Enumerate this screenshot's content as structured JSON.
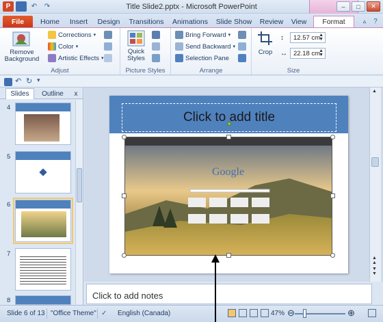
{
  "window": {
    "title": "Title Slide2.pptx - Microsoft PowerPoint",
    "controls": [
      "–",
      "□",
      "✕"
    ]
  },
  "tabs": [
    {
      "label": "File"
    },
    {
      "label": "Home"
    },
    {
      "label": "Insert"
    },
    {
      "label": "Design"
    },
    {
      "label": "Transitions"
    },
    {
      "label": "Animations"
    },
    {
      "label": "Slide Show"
    },
    {
      "label": "Review"
    },
    {
      "label": "View"
    },
    {
      "label": "Format"
    }
  ],
  "ribbon": {
    "adjust": {
      "remove_background": "Remove Background",
      "corrections": "Corrections",
      "color": "Color",
      "artistic_effects": "Artistic Effects",
      "group_label": "Adjust"
    },
    "picture_styles": {
      "quick_styles": "Quick Styles",
      "group_label": "Picture Styles"
    },
    "arrange": {
      "bring_forward": "Bring Forward",
      "send_backward": "Send Backward",
      "selection_pane": "Selection Pane",
      "group_label": "Arrange"
    },
    "size": {
      "crop": "Crop",
      "height": "12.57 cm",
      "width": "22.18 cm",
      "group_label": "Size"
    }
  },
  "left_panel": {
    "tabs": [
      "Slides",
      "Outline"
    ],
    "close": "x",
    "thumbnails": [
      {
        "number": "4"
      },
      {
        "number": "5"
      },
      {
        "number": "6",
        "selected": true
      },
      {
        "number": "7"
      },
      {
        "number": "8"
      }
    ]
  },
  "slide": {
    "title_placeholder": "Click to add title",
    "picture_search_logo": "Google"
  },
  "notes": {
    "placeholder": "Click to add notes"
  },
  "status_bar": {
    "slide_info": "Slide 6 of 13",
    "theme": "\"Office Theme\"",
    "language": "English (Canada)",
    "zoom": "47%"
  },
  "colors": {
    "accent": "#4f81bd",
    "file_tab": "#d24726",
    "context_tab": "#c88ab8"
  }
}
